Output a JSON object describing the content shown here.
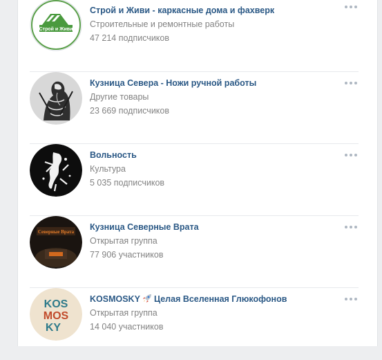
{
  "groups": [
    {
      "name": "Строй и Живи - каркасные дома и фахверк",
      "category": "Строительные и ремонтные работы",
      "count": "47 214 подписчиков",
      "avatar_text": "Строй и Живи",
      "avatar_icon": "house-logo-icon"
    },
    {
      "name": "Кузница Севера - Ножи ручной работы",
      "category": "Другие товары",
      "count": "23 669 подписчиков",
      "avatar_icon": "warrior-sketch-icon"
    },
    {
      "name": "Вольность",
      "category": "Культура",
      "count": "5 035 подписчиков",
      "avatar_icon": "splatter-symbol-icon"
    },
    {
      "name": "Кузница Северные Врата",
      "category": "Открытая группа",
      "count": "77 906 участников",
      "avatar_text": "Северные Врата",
      "avatar_icon": "forge-logo-icon"
    },
    {
      "name_prefix": "KOSMOSKY",
      "name_suffix": "Целая Вселенная Глюкофонов",
      "category": "Открытая группа",
      "count": "14 040 участников",
      "avatar_text_lines": [
        "KOS",
        "MOS",
        "KY"
      ],
      "avatar_icon": "kosmosky-logo-icon",
      "name_emoji_icon": "rocket-icon"
    }
  ],
  "colors": {
    "link": "#2a5885",
    "secondary_text": "#828282",
    "divider": "#e7e8ec",
    "background": "#edeef0",
    "logo_green": "#4a9a3e"
  }
}
